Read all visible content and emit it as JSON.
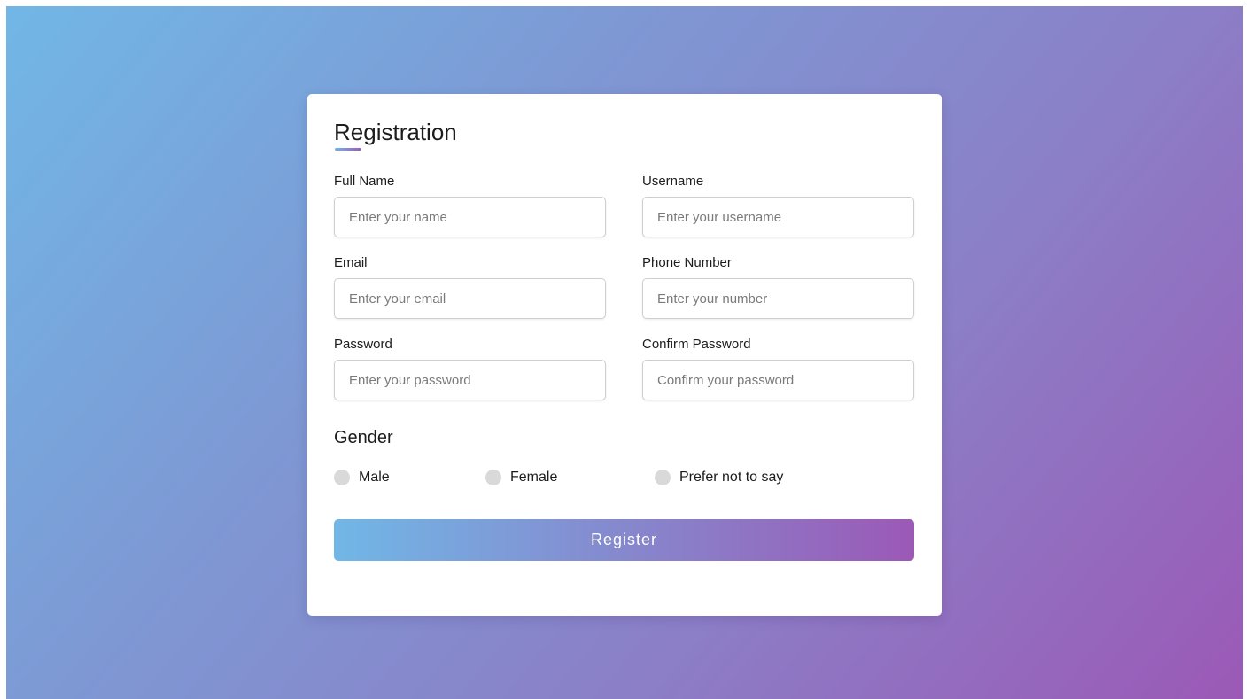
{
  "form": {
    "title": "Registration",
    "fields": [
      {
        "label": "Full Name",
        "placeholder": "Enter your name",
        "value": ""
      },
      {
        "label": "Username",
        "placeholder": "Enter your username",
        "value": ""
      },
      {
        "label": "Email",
        "placeholder": "Enter your email",
        "value": ""
      },
      {
        "label": "Phone Number",
        "placeholder": "Enter your number",
        "value": ""
      },
      {
        "label": "Password",
        "placeholder": "Enter your password",
        "value": ""
      },
      {
        "label": "Confirm Password",
        "placeholder": "Confirm your password",
        "value": ""
      }
    ],
    "gender": {
      "title": "Gender",
      "options": [
        "Male",
        "Female",
        "Prefer not to say"
      ],
      "selected": null
    },
    "register_label": "Register"
  },
  "colors": {
    "gradient_start": "#71b7e6",
    "gradient_end": "#9b59b6",
    "radio_unselected": "#d9d9d9"
  }
}
